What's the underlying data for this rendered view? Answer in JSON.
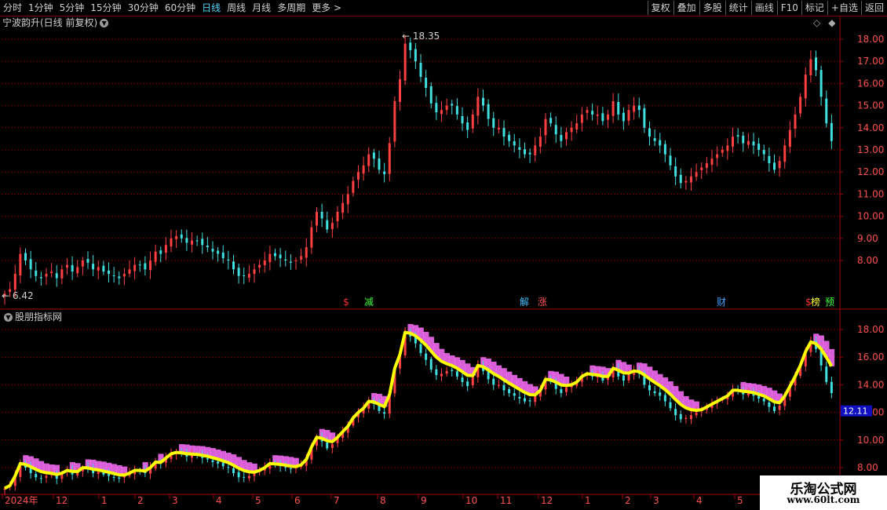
{
  "toolbar": {
    "periods": [
      "分时",
      "1分钟",
      "5分钟",
      "15分钟",
      "30分钟",
      "60分钟",
      "日线",
      "周线",
      "月线",
      "多周期",
      "更多 >"
    ],
    "active_period": "日线",
    "right_buttons": [
      "复权",
      "叠加",
      "多股",
      "统计",
      "画线",
      "F10",
      "标记",
      "+自选",
      "返回"
    ]
  },
  "main_panel": {
    "title": "宁波韵升(日线 前复权)",
    "high_label": "18.35",
    "low_label": "6.42",
    "markers": [
      {
        "text": "$",
        "color": "#ff3030"
      },
      {
        "text": "减",
        "color": "#40ff40"
      },
      {
        "text": "解",
        "color": "#40c0ff"
      },
      {
        "text": "涨",
        "color": "#ff5050"
      },
      {
        "text": "财",
        "color": "#40a0ff"
      },
      {
        "text": "$",
        "color": "#ff3030"
      },
      {
        "text": "榜",
        "color": "#ffff40"
      },
      {
        "text": "预",
        "color": "#40ff40"
      }
    ],
    "y_ticks": [
      "18.00",
      "17.00",
      "16.00",
      "15.00",
      "14.00",
      "13.00",
      "12.00",
      "11.00",
      "10.00",
      "9.00",
      "8.00"
    ]
  },
  "indicator_panel": {
    "title": "股朋指标网",
    "y_ticks": [
      "18.00",
      "16.00",
      "14.00",
      "12.00",
      "10.00",
      "8.00"
    ],
    "current_value": "12.11"
  },
  "x_axis": {
    "labels": [
      "2024年",
      "12",
      "1",
      "2",
      "3",
      "4",
      "5",
      "6",
      "7",
      "8",
      "9",
      "10",
      "11",
      "12",
      "1",
      "2",
      "3",
      "4",
      "5"
    ]
  },
  "colors": {
    "up": "#ff4040",
    "down": "#40e0e0",
    "grid": "#6e0000",
    "indicator_line": "#ffff00",
    "indicator_fill": "#ff70ff"
  },
  "watermark": {
    "line1": "乐淘公式网",
    "line2": "www.60lt.com"
  },
  "chart_data": {
    "type": "candlestick",
    "price_range": [
      6.42,
      18.35
    ],
    "closes": [
      6.5,
      6.7,
      7.4,
      8.3,
      8.0,
      7.6,
      7.3,
      7.2,
      7.4,
      7.5,
      7.2,
      7.6,
      7.8,
      7.5,
      7.7,
      8.0,
      7.9,
      7.6,
      7.7,
      7.5,
      7.4,
      7.3,
      7.2,
      7.4,
      7.6,
      7.8,
      7.8,
      7.6,
      8.0,
      8.4,
      8.3,
      8.7,
      9.0,
      9.1,
      9.0,
      8.8,
      8.9,
      8.9,
      8.7,
      8.6,
      8.4,
      8.3,
      8.1,
      8.0,
      7.6,
      7.3,
      7.3,
      7.4,
      7.6,
      7.8,
      8.0,
      8.3,
      8.2,
      8.1,
      8.0,
      7.9,
      8.0,
      8.2,
      8.6,
      9.5,
      10.2,
      9.9,
      9.4,
      9.7,
      10.2,
      10.6,
      11.0,
      11.6,
      12.0,
      12.3,
      12.8,
      12.6,
      12.1,
      11.9,
      13.3,
      15.2,
      16.2,
      17.8,
      17.5,
      17.0,
      16.3,
      15.8,
      15.1,
      14.7,
      14.8,
      15.0,
      15.0,
      14.6,
      14.2,
      13.9,
      14.6,
      15.4,
      15.0,
      14.4,
      14.0,
      14.0,
      13.6,
      13.4,
      13.2,
      13.0,
      12.8,
      12.8,
      13.2,
      13.6,
      14.4,
      14.2,
      13.7,
      13.4,
      13.8,
      14.0,
      14.2,
      14.6,
      14.8,
      14.6,
      14.6,
      14.3,
      14.6,
      15.2,
      14.6,
      14.3,
      14.8,
      15.0,
      14.8,
      14.0,
      13.6,
      13.4,
      13.2,
      12.8,
      12.3,
      11.8,
      11.5,
      11.6,
      11.8,
      12.0,
      12.2,
      12.4,
      12.6,
      12.8,
      13.0,
      13.2,
      13.6,
      13.6,
      13.3,
      13.4,
      13.2,
      13.0,
      12.8,
      12.4,
      12.1,
      12.5,
      13.2,
      13.9,
      14.6,
      15.4,
      16.4,
      17.1,
      16.6,
      15.4,
      14.2,
      13.4
    ]
  }
}
